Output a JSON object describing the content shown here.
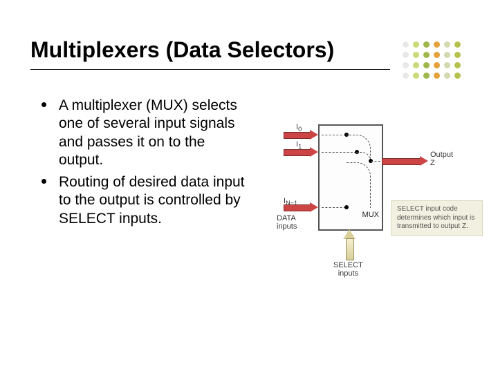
{
  "title": "Multiplexers (Data Selectors)",
  "bullets": [
    "A multiplexer (MUX) selects one of several input signals and passes it on to the output.",
    "Routing of desired data input to the output is controlled by SELECT inputs."
  ],
  "diagram": {
    "input_labels": {
      "i0": "I₀",
      "i1": "I₁",
      "in": "I_{N−1}"
    },
    "data_inputs_label": "DATA\ninputs",
    "mux_label": "MUX",
    "output_label": "Output\nZ",
    "select_label": "SELECT\ninputs",
    "note": "SELECT input code determines which input is transmitted to output Z."
  }
}
